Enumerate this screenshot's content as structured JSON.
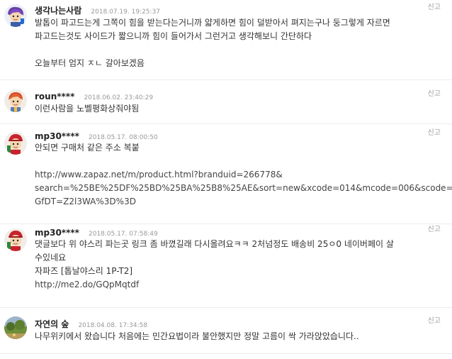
{
  "report_label": "신고",
  "comments": [
    {
      "nickname": "생각나는사람",
      "date": "2018.07.19. 19:25:37",
      "avatar_icon": "purple-haired-character-icon",
      "lines": [
        "발톱이 파고드는게 그쪽이 힘을 받는다는거니까 얇게하면 힘이 덜받아서 펴지는구나 둥그렇게 자르면",
        "파고드는것도 사이드가 짧으니까 힘이 들어가서 그런거고 생각해보니 간단하다",
        "",
        "오늘부터 엄지 ㅈㄴ 갈아보겠음"
      ]
    },
    {
      "nickname": "roun****",
      "date": "2018.06.02. 23:40:29",
      "avatar_icon": "red-haired-character-icon",
      "lines": [
        "이런사람을 노벨평화상줘야됨"
      ]
    },
    {
      "nickname": "mp30****",
      "date": "2018.05.17. 08:00:50",
      "avatar_icon": "red-cap-character-icon",
      "lines": [
        "안되면 구매처 같은 주소 복붙",
        "",
        "http://www.zapaz.net/m/product.html?branduid=266778&",
        "search=%25BE%25DF%25BD%25BA%25B8%25AE&sort=new&xcode=014&mcode=006&scode=&",
        "GfDT=Z2l3WA%3D%3D"
      ]
    },
    {
      "nickname": "mp30****",
      "date": "2018.05.17. 07:58:49",
      "avatar_icon": "red-cap-character-icon",
      "lines": [
        "댓글보다 위 야스리 파는곳 링크 좀 바꼈길래 다시올려요ㅋㅋ 2처넘정도 배송비 25ㅇ0 네이버페이 살",
        "수있네요",
        "자파즈 [톱날야스리 1P-T2]",
        "http://me2.do/GQpMqtdf"
      ]
    },
    {
      "nickname": "자연의 숲",
      "date": "2018.04.08. 17:34:58",
      "avatar_icon": "landscape-photo-icon",
      "lines": [
        "나무위키에서 왔습니다 처음에는 민간요법이라 불안했지만 정말 고름이 싹 가라앉았습니다.."
      ]
    }
  ]
}
